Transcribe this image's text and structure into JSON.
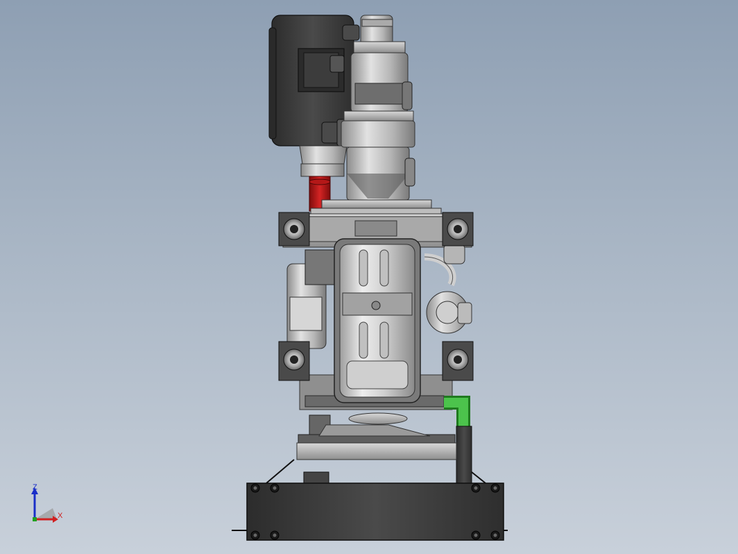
{
  "triad": {
    "z_label": "Z",
    "x_label": "X",
    "z_color": "#1a2ec8",
    "x_color": "#d02020",
    "y_color": "#20a020"
  },
  "colors": {
    "background_top": "#8e9fb3",
    "background_bottom": "#c8d0da",
    "housing_dark": "#3a3a3a",
    "metal_light": "#c9c9c9",
    "metal_mid": "#9a9a9a",
    "red_pipe": "#c41a1a",
    "green_pipe": "#36b336"
  }
}
